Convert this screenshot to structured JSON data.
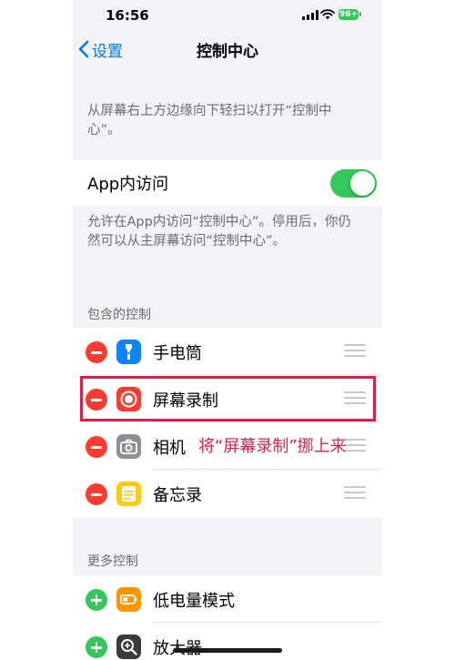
{
  "status_bar": {
    "time": "16:56",
    "battery": "96+"
  },
  "nav": {
    "back_label": "设置",
    "title": "控制中心"
  },
  "top_description": "从屏幕右上方边缘向下轻扫以打开“控制中心”。",
  "access_in_apps": {
    "label": "App内访问",
    "enabled": true
  },
  "access_description": "允许在App内访问“控制中心”。停用后，你仍然可以从主屏幕访问“控制中心”。",
  "included": {
    "header": "包含的控制",
    "items": [
      {
        "label": "手电筒",
        "icon": "flashlight-icon",
        "color": "#0a84ff"
      },
      {
        "label": "屏幕录制",
        "icon": "screen-record-icon",
        "color": "#ff3b30"
      },
      {
        "label": "相机",
        "icon": "camera-icon",
        "color": "#8e8e93"
      },
      {
        "label": "备忘录",
        "icon": "notes-icon",
        "color": "#ffcc00"
      }
    ]
  },
  "more": {
    "header": "更多控制",
    "items": [
      {
        "label": "低电量模式",
        "icon": "low-power-mode-icon",
        "color": "#ff9500"
      },
      {
        "label": "放大器",
        "icon": "magnifier-icon",
        "color": "#3a3a3c"
      }
    ]
  },
  "annotation": {
    "text": "将“屏幕录制”挪上来",
    "color": "#e11d48"
  },
  "colors": {
    "accent": "#007aff",
    "remove": "#ff3b30",
    "add": "#34c759"
  }
}
